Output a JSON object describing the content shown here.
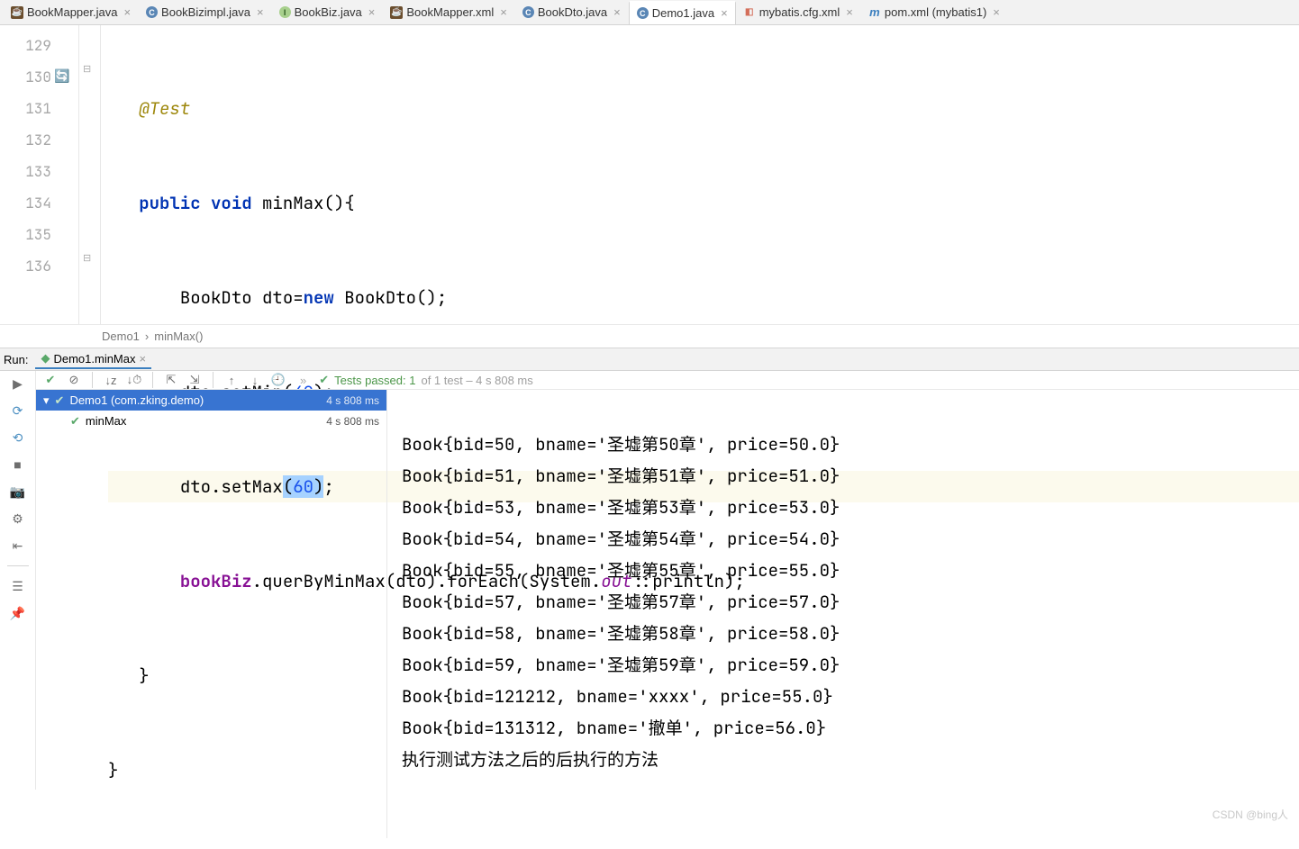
{
  "tabs": [
    {
      "label": "BookMapper.java",
      "icon": "java"
    },
    {
      "label": "BookBizimpl.java",
      "icon": "c"
    },
    {
      "label": "BookBiz.java",
      "icon": "i"
    },
    {
      "label": "BookMapper.xml",
      "icon": "java"
    },
    {
      "label": "BookDto.java",
      "icon": "c"
    },
    {
      "label": "Demo1.java",
      "icon": "c",
      "active": true
    },
    {
      "label": "mybatis.cfg.xml",
      "icon": "cfg"
    },
    {
      "label": "pom.xml (mybatis1)",
      "icon": "m"
    }
  ],
  "gutter": {
    "lines": [
      "129",
      "130",
      "131",
      "132",
      "133",
      "134",
      "135",
      "136"
    ]
  },
  "code": {
    "l129_annotation": "@Test",
    "l130_kw1": "public",
    "l130_kw2": "void",
    "l130_fn": " minMax(){",
    "l131_a": "BookDto dto=",
    "l131_kw": "new",
    "l131_b": " BookDto();",
    "l132": "dto.setMin(",
    "l132_num": "40",
    "l132_end": ");",
    "l133": "dto.setMax",
    "l133_paren1": "(",
    "l133_num": "60",
    "l133_paren2": ")",
    "l133_end": ";",
    "l134_field": "bookBiz",
    "l134_a": ".querByMinMax(dto).forEach(System.",
    "l134_out": "out",
    "l134_b": "::println);",
    "l135": "}",
    "l136": "}"
  },
  "breadcrumb": {
    "a": "Demo1",
    "sep": "›",
    "b": "minMax()"
  },
  "run": {
    "label": "Run:",
    "tab": "Demo1.minMax",
    "status_prefix": "Tests passed: 1",
    "status_suffix": " of 1 test – 4 s 808 ms"
  },
  "tree": {
    "root": "Demo1 (com.zking.demo)",
    "root_time": "4 s 808 ms",
    "child": "minMax",
    "child_time": "4 s 808 ms"
  },
  "console_lines": [
    "Book{bid=50, bname='圣墟第50章', price=50.0}",
    "Book{bid=51, bname='圣墟第51章', price=51.0}",
    "Book{bid=53, bname='圣墟第53章', price=53.0}",
    "Book{bid=54, bname='圣墟第54章', price=54.0}",
    "Book{bid=55, bname='圣墟第55章', price=55.0}",
    "Book{bid=57, bname='圣墟第57章', price=57.0}",
    "Book{bid=58, bname='圣墟第58章', price=58.0}",
    "Book{bid=59, bname='圣墟第59章', price=59.0}",
    "Book{bid=121212, bname='xxxx', price=55.0}",
    "Book{bid=131312, bname='撤单', price=56.0}",
    "执行测试方法之后的后执行的方法"
  ],
  "watermark": "CSDN @bing人"
}
